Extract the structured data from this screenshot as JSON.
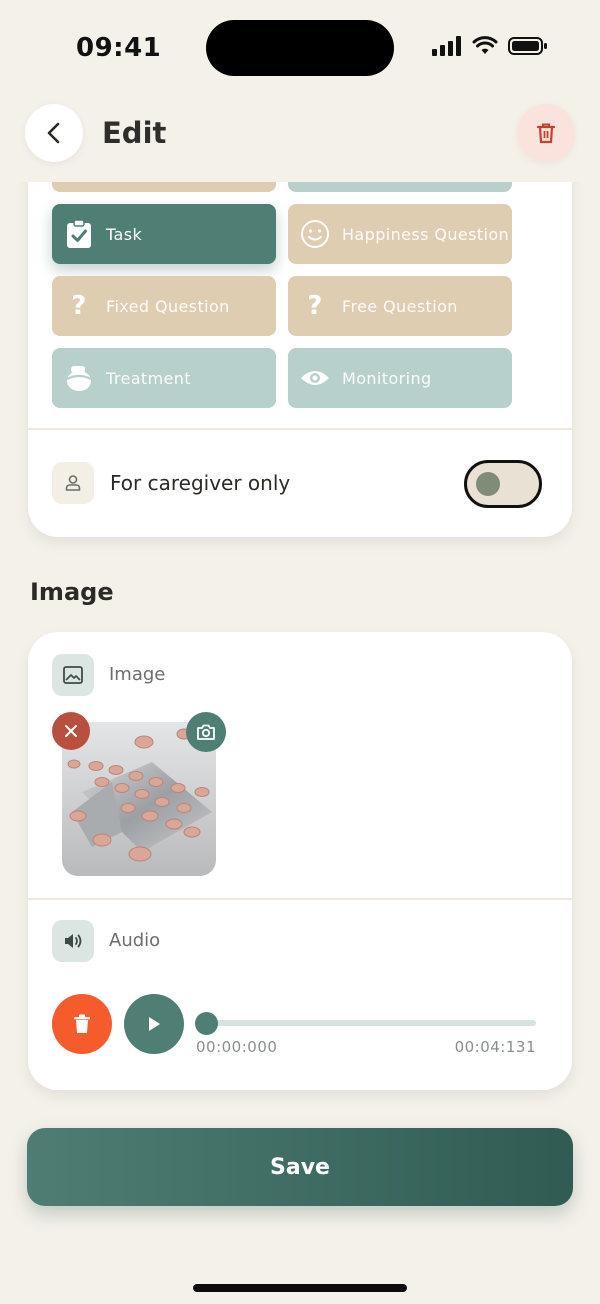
{
  "status_bar": {
    "time": "09:41"
  },
  "header": {
    "title": "Edit"
  },
  "type_buttons": [
    {
      "label": "Task",
      "icon": "clipboard-check-icon",
      "active": true
    },
    {
      "label": "Happiness Question",
      "icon": "smiley-icon"
    },
    {
      "label": "Fixed Question",
      "icon": "question-icon",
      "glyph": "?"
    },
    {
      "label": "Free Question",
      "icon": "question-icon",
      "glyph": "?"
    },
    {
      "label": "Treatment",
      "icon": "medicine-icon"
    },
    {
      "label": "Monitoring",
      "icon": "eye-icon"
    }
  ],
  "caregiver": {
    "label": "For caregiver only",
    "enabled": false
  },
  "image_section": {
    "title": "Image",
    "row_label": "Image"
  },
  "audio": {
    "label": "Audio",
    "current_time": "00:00:000",
    "duration": "00:04:131",
    "progress": 0
  },
  "save_label": "Save",
  "colors": {
    "accent": "#4e7e74",
    "beige": "#dfcdb1",
    "teal_light": "#b8d0cb",
    "danger": "#f45c2b",
    "background": "#f4f1e9"
  }
}
